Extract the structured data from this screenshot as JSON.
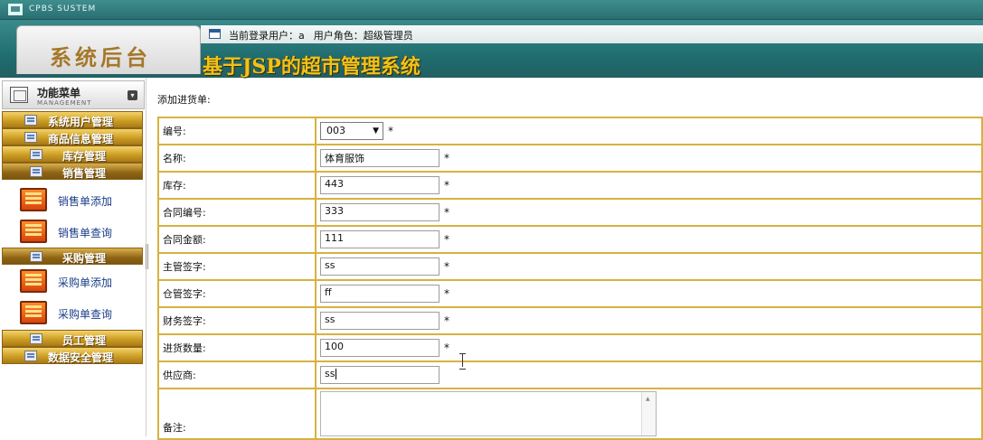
{
  "window": {
    "title": "CPBS SUSTEM"
  },
  "header": {
    "logo_text": "系统后台",
    "current_user_label": "当前登录用户：",
    "current_user": "a",
    "role_label": "用户角色：",
    "role": "超级管理员",
    "system_title": "基于JSP的超市管理系统"
  },
  "sidebar": {
    "menu_title": "功能菜单",
    "menu_subtitle": "MANAGEMENT",
    "categories": [
      {
        "label": "系统用户管理"
      },
      {
        "label": "商品信息管理"
      },
      {
        "label": "库存管理"
      },
      {
        "label": "销售管理"
      },
      {
        "label": "采购管理"
      },
      {
        "label": "员工管理"
      },
      {
        "label": "数据安全管理"
      }
    ],
    "sales_items": [
      {
        "label": "销售单添加"
      },
      {
        "label": "销售单查询"
      }
    ],
    "purchase_items": [
      {
        "label": "采购单添加"
      },
      {
        "label": "采购单查询"
      }
    ]
  },
  "main": {
    "section_title": "添加进货单:",
    "required_mark": "*",
    "fields": {
      "number": {
        "label": "编号:",
        "value": "003"
      },
      "name": {
        "label": "名称:",
        "value": "体育服饰"
      },
      "stock": {
        "label": "库存:",
        "value": "443"
      },
      "contract_no": {
        "label": "合同编号:",
        "value": "333"
      },
      "contract_amount": {
        "label": "合同金额:",
        "value": "111"
      },
      "manager_sign": {
        "label": "主管签字:",
        "value": "ss"
      },
      "warehouse_sign": {
        "label": "仓管签字:",
        "value": "ff"
      },
      "finance_sign": {
        "label": "财务签字:",
        "value": "ss"
      },
      "quantity": {
        "label": "进货数量:",
        "value": "100"
      },
      "supplier": {
        "label": "供应商:",
        "value": "ss"
      },
      "remark": {
        "label": "备注:",
        "value": ""
      }
    }
  }
}
